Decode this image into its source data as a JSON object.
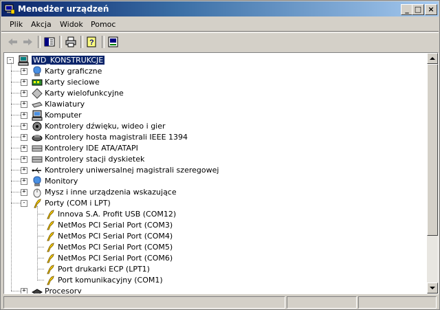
{
  "window": {
    "title": "Menedżer urządzeń",
    "minimize_label": "_",
    "maximize_label": "□",
    "close_label": "×"
  },
  "menu": {
    "items": [
      "Plik",
      "Akcja",
      "Widok",
      "Pomoc"
    ]
  },
  "toolbar": {
    "buttons": [
      "back-icon",
      "forward-icon",
      "show-hide-console-tree-icon",
      "print-icon",
      "help-icon",
      "properties-icon"
    ]
  },
  "tree": {
    "root": {
      "label": "WD_KONSTRUKCJE",
      "icon": "computer-icon",
      "expanded": true
    },
    "items": [
      {
        "label": "Karty graficzne",
        "icon": "display-adapter-icon",
        "expand": "+"
      },
      {
        "label": "Karty sieciowe",
        "icon": "network-adapter-icon",
        "expand": "+"
      },
      {
        "label": "Karty wielofunkcyjne",
        "icon": "multifunction-adapter-icon",
        "expand": "+"
      },
      {
        "label": "Klawiatury",
        "icon": "keyboard-icon",
        "expand": "+"
      },
      {
        "label": "Komputer",
        "icon": "computer-icon",
        "expand": "+"
      },
      {
        "label": "Kontrolery dźwięku, wideo i gier",
        "icon": "sound-icon",
        "expand": "+"
      },
      {
        "label": "Kontrolery hosta magistrali IEEE 1394",
        "icon": "ieee1394-icon",
        "expand": "+"
      },
      {
        "label": "Kontrolery IDE ATA/ATAPI",
        "icon": "ide-controller-icon",
        "expand": "+"
      },
      {
        "label": "Kontrolery stacji dyskietek",
        "icon": "floppy-controller-icon",
        "expand": "+"
      },
      {
        "label": "Kontrolery uniwersalnej magistrali szeregowej",
        "icon": "usb-icon",
        "expand": "+"
      },
      {
        "label": "Monitory",
        "icon": "monitor-icon",
        "expand": "+"
      },
      {
        "label": "Mysz i inne urządzenia wskazujące",
        "icon": "mouse-icon",
        "expand": "+"
      },
      {
        "label": "Porty (COM i LPT)",
        "icon": "port-icon",
        "expand": "-",
        "children": [
          "Innova S.A. Profit USB (COM12)",
          "NetMos PCI Serial Port (COM3)",
          "NetMos PCI Serial Port (COM4)",
          "NetMos PCI Serial Port (COM5)",
          "NetMos PCI Serial Port (COM6)",
          "Port drukarki ECP (LPT1)",
          "Port komunikacyjny (COM1)"
        ]
      },
      {
        "label": "Procesory",
        "icon": "processor-icon",
        "expand": "+"
      }
    ]
  },
  "colors": {
    "title_start": "#0a246a",
    "title_end": "#a6caf0",
    "selection": "#0a246a",
    "face": "#d4d0c8"
  }
}
